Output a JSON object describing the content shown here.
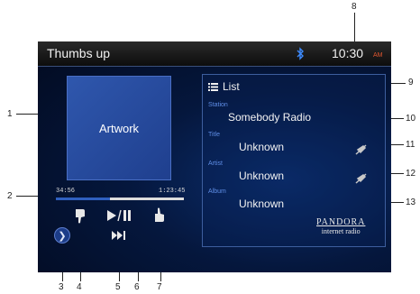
{
  "topbar": {
    "title": "Thumbs up",
    "time": "10:30",
    "ampm": "AM"
  },
  "player": {
    "artwork_label": "Artwork",
    "elapsed": "34:56",
    "total": "1:23:45",
    "progress": 0.42
  },
  "list": {
    "header": "List",
    "station_label": "Station",
    "station_value": "Somebody Radio",
    "title_label": "Title",
    "title_value": "Unknown",
    "artist_label": "Artist",
    "artist_value": "Unknown",
    "album_label": "Album",
    "album_value": "Unknown"
  },
  "branding": {
    "name": "PANDORA",
    "subtitle": "internet radio"
  },
  "callouts": [
    "1",
    "2",
    "3",
    "4",
    "5",
    "6",
    "7",
    "8",
    "9",
    "10",
    "11",
    "12",
    "13"
  ],
  "colors": {
    "accent_blue": "#2f5fbf",
    "ampm_orange": "#e0562f",
    "label_blue": "#5f8ee6"
  },
  "icons": {
    "bluetooth": "bluetooth-icon",
    "menu": "chevron-right-icon",
    "thumbs_down": "thumbs-down-icon",
    "thumbs_up": "thumbs-up-icon",
    "play_pause": "play-pause-icon",
    "skip": "skip-next-icon",
    "list": "list-icon"
  }
}
